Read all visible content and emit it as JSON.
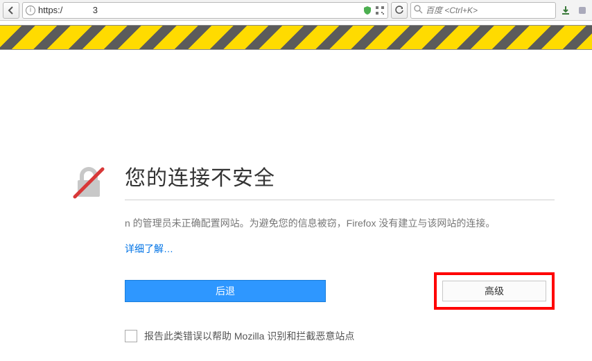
{
  "toolbar": {
    "url_value": "https:/            3",
    "search_placeholder": "百度 <Ctrl+K>"
  },
  "page": {
    "title": "您的连接不安全",
    "message": "n 的管理员未正确配置网站。为避免您的信息被窃，Firefox 没有建立与该网站的连接。",
    "learn_more": "详细了解…",
    "back_label": "后退",
    "advanced_label": "高级",
    "report_label": "报告此类错误以帮助 Mozilla 识别和拦截恶意站点"
  }
}
